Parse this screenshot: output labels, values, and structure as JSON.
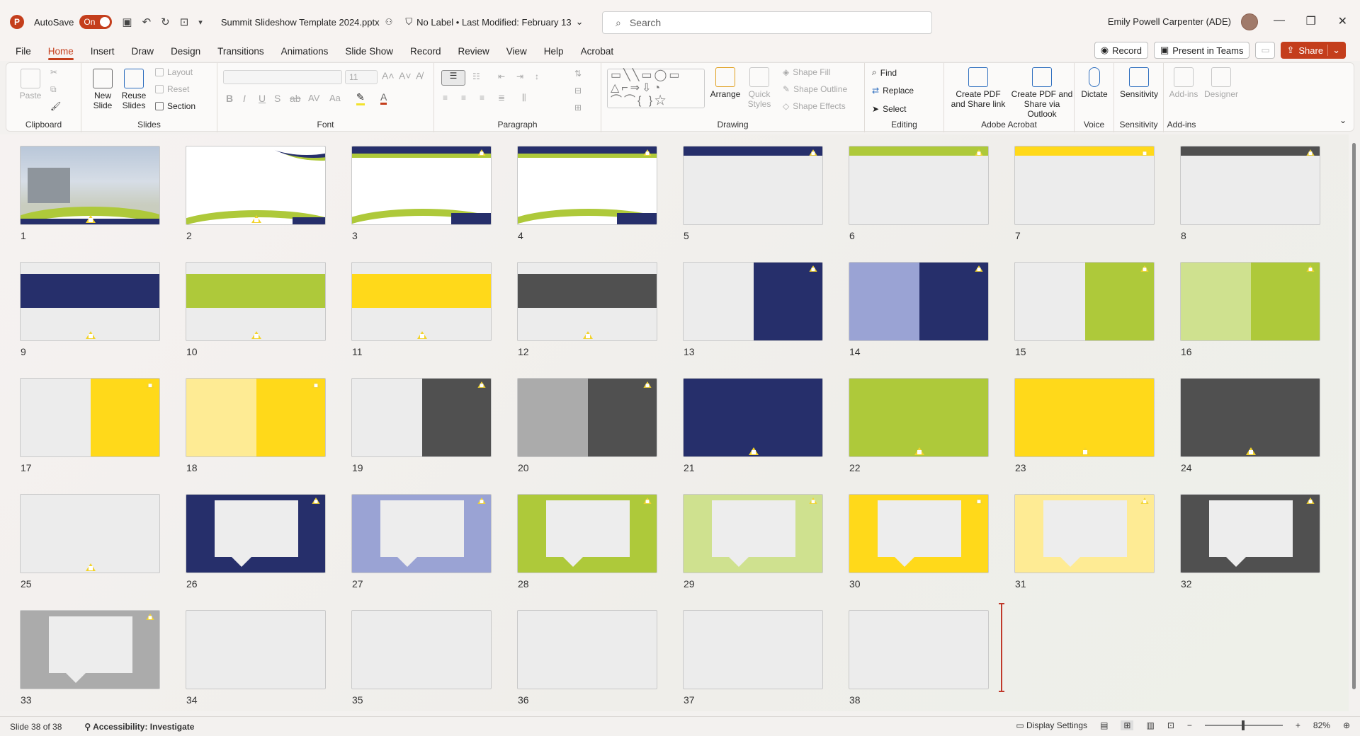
{
  "titlebar": {
    "autosave_label": "AutoSave",
    "autosave_state": "On",
    "filename": "Summit Slideshow Template 2024.pptx",
    "label_info": "No Label  •  Last Modified: February 13",
    "search_placeholder": "Search",
    "user_name": "Emily Powell Carpenter (ADE)"
  },
  "menu": {
    "tabs": [
      "File",
      "Home",
      "Insert",
      "Draw",
      "Design",
      "Transitions",
      "Animations",
      "Slide Show",
      "Record",
      "Review",
      "View",
      "Help",
      "Acrobat"
    ],
    "active": "Home",
    "record_label": "Record",
    "present_label": "Present in Teams",
    "share_label": "Share"
  },
  "ribbon": {
    "clipboard": {
      "paste": "Paste",
      "label": "Clipboard"
    },
    "slides": {
      "new_slide": "New Slide",
      "reuse": "Reuse Slides",
      "layout": "Layout",
      "reset": "Reset",
      "section": "Section",
      "label": "Slides"
    },
    "font": {
      "size": "11",
      "label": "Font"
    },
    "paragraph": {
      "label": "Paragraph"
    },
    "drawing": {
      "arrange": "Arrange",
      "quick_styles": "Quick Styles",
      "shape_fill": "Shape Fill",
      "shape_outline": "Shape Outline",
      "shape_effects": "Shape Effects",
      "label": "Drawing"
    },
    "editing": {
      "find": "Find",
      "replace": "Replace",
      "select": "Select",
      "label": "Editing"
    },
    "acrobat": {
      "pdf_share": "Create PDF and Share link",
      "pdf_outlook": "Create PDF and Share via Outlook",
      "label": "Adobe Acrobat"
    },
    "voice": {
      "dictate": "Dictate",
      "label": "Voice"
    },
    "sensitivity": {
      "btn": "Sensitivity",
      "label": "Sensitivity"
    },
    "addins": {
      "addins": "Add-ins",
      "designer": "Designer",
      "label": "Add-ins"
    }
  },
  "colors": {
    "navy": "#262f6b",
    "green": "#aec93a",
    "yellow": "#ffd91a",
    "gray": "#505050",
    "lavender": "#9aa3d4",
    "light_green": "#cfe18f",
    "light_yellow": "#feeb94",
    "light_gray": "#ababab",
    "accent": "#c43e1c"
  },
  "slides": [
    {
      "n": "1",
      "style": "photo"
    },
    {
      "n": "2",
      "style": "wave-white"
    },
    {
      "n": "3",
      "style": "header-wave"
    },
    {
      "n": "4",
      "style": "header-wave"
    },
    {
      "n": "5",
      "style": "top-bar",
      "color": "navy"
    },
    {
      "n": "6",
      "style": "top-bar",
      "color": "green"
    },
    {
      "n": "7",
      "style": "top-bar",
      "color": "yellow"
    },
    {
      "n": "8",
      "style": "top-bar",
      "color": "gray"
    },
    {
      "n": "9",
      "style": "mid-band",
      "color": "navy"
    },
    {
      "n": "10",
      "style": "mid-band",
      "color": "green"
    },
    {
      "n": "11",
      "style": "mid-band",
      "color": "yellow"
    },
    {
      "n": "12",
      "style": "mid-band",
      "color": "gray"
    },
    {
      "n": "13",
      "style": "split",
      "left": "blank",
      "color": "navy"
    },
    {
      "n": "14",
      "style": "split",
      "left": "lavender",
      "color": "navy"
    },
    {
      "n": "15",
      "style": "split",
      "left": "blank",
      "color": "green"
    },
    {
      "n": "16",
      "style": "split",
      "left": "light_green",
      "color": "green"
    },
    {
      "n": "17",
      "style": "split",
      "left": "blank",
      "color": "yellow"
    },
    {
      "n": "18",
      "style": "split",
      "left": "light_yellow",
      "color": "yellow"
    },
    {
      "n": "19",
      "style": "split",
      "left": "blank",
      "color": "gray"
    },
    {
      "n": "20",
      "style": "split",
      "left": "light_gray",
      "color": "gray"
    },
    {
      "n": "21",
      "style": "full",
      "color": "navy"
    },
    {
      "n": "22",
      "style": "full",
      "color": "green"
    },
    {
      "n": "23",
      "style": "full",
      "color": "yellow"
    },
    {
      "n": "24",
      "style": "full",
      "color": "gray"
    },
    {
      "n": "25",
      "style": "blank-logo"
    },
    {
      "n": "26",
      "style": "bubble",
      "color": "navy"
    },
    {
      "n": "27",
      "style": "bubble",
      "color": "lavender"
    },
    {
      "n": "28",
      "style": "bubble",
      "color": "green"
    },
    {
      "n": "29",
      "style": "bubble",
      "color": "light_green"
    },
    {
      "n": "30",
      "style": "bubble",
      "color": "yellow"
    },
    {
      "n": "31",
      "style": "bubble",
      "color": "light_yellow"
    },
    {
      "n": "32",
      "style": "bubble",
      "color": "gray"
    },
    {
      "n": "33",
      "style": "bubble",
      "color": "light_gray"
    },
    {
      "n": "34",
      "style": "empty"
    },
    {
      "n": "35",
      "style": "empty"
    },
    {
      "n": "36",
      "style": "empty"
    },
    {
      "n": "37",
      "style": "empty"
    },
    {
      "n": "38",
      "style": "empty"
    }
  ],
  "status": {
    "slide_counter": "Slide 38 of 38",
    "accessibility": "Accessibility: Investigate",
    "display_settings": "Display Settings",
    "zoom": "82%"
  }
}
